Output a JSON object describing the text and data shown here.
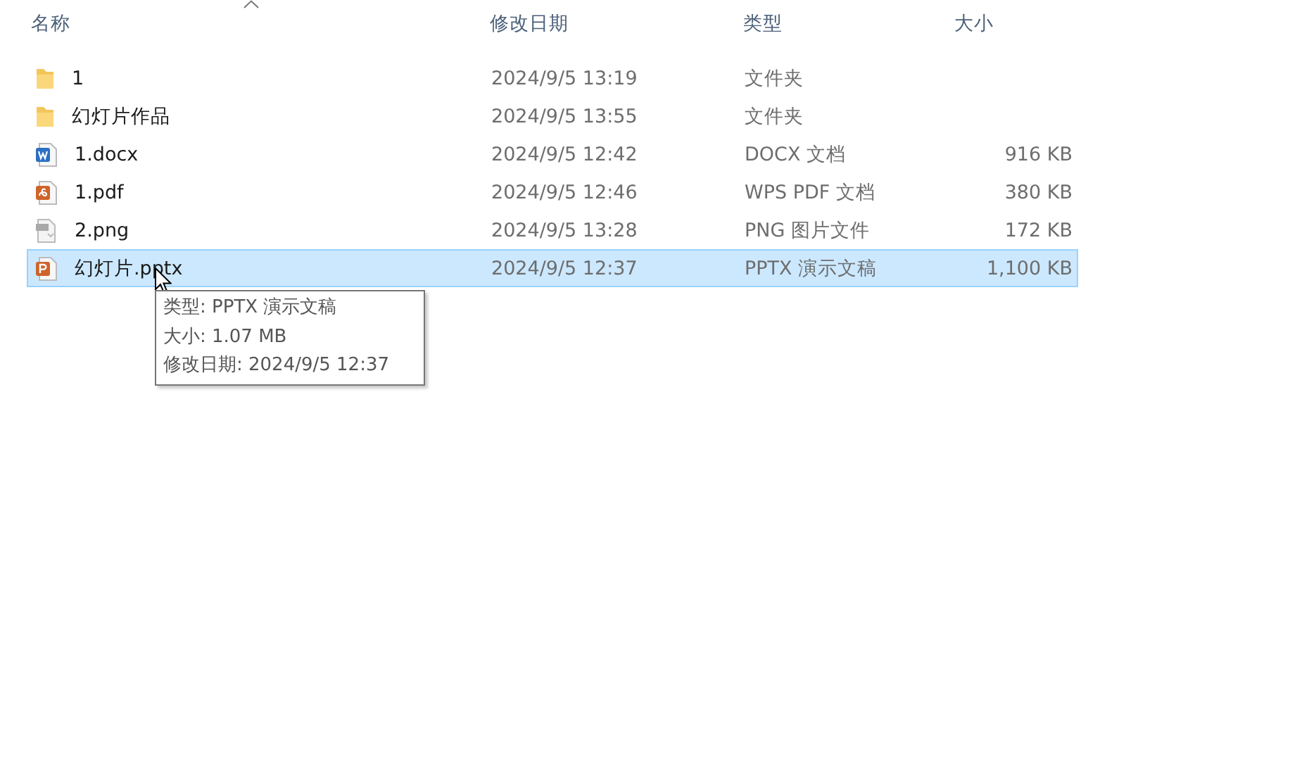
{
  "columns": [
    {
      "label": "名称",
      "sorted": true
    },
    {
      "label": "修改日期",
      "sorted": false
    },
    {
      "label": "类型",
      "sorted": false
    },
    {
      "label": "大小",
      "sorted": false
    }
  ],
  "files": [
    {
      "kind": "folder",
      "name": "1",
      "modified": "2024/9/5 13:19",
      "type": "文件夹",
      "selected": false
    },
    {
      "kind": "folder",
      "name": "幻灯片作品",
      "modified": "2024/9/5 13:55",
      "type": "文件夹",
      "selected": false
    },
    {
      "kind": "word",
      "name": "1.docx",
      "modified": "2024/9/5 12:42",
      "type": "DOCX 文档",
      "size": "916 KB",
      "selected": false
    },
    {
      "kind": "pdf",
      "name": "1.pdf",
      "modified": "2024/9/5 12:46",
      "type": "WPS PDF 文档",
      "size": "380 KB",
      "selected": false
    },
    {
      "kind": "image",
      "name": "2.png",
      "modified": "2024/9/5 13:28",
      "type": "PNG 图片文件",
      "size": "172 KB",
      "selected": false
    },
    {
      "kind": "slides",
      "name": "幻灯片.pptx",
      "modified": "2024/9/5 12:37",
      "type": "PPTX 演示文稿",
      "size": "1,100 KB",
      "selected": true
    }
  ],
  "tooltip": {
    "lines": [
      "类型: PPTX 演示文稿",
      "大小: 1.07 MB",
      "修改日期: 2024/9/5 12:37"
    ]
  }
}
